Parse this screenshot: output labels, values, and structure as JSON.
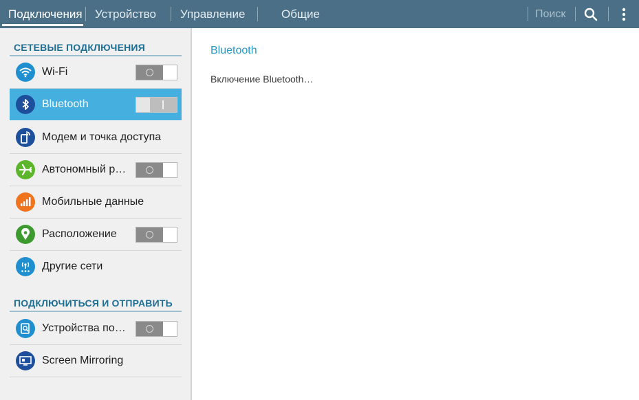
{
  "top_bar": {
    "tabs": [
      {
        "label": "Подключения",
        "active": true
      },
      {
        "label": "Устройство",
        "active": false
      },
      {
        "label": "Управление",
        "active": false
      },
      {
        "label": "Общие",
        "active": false
      }
    ],
    "search_label": "Поиск",
    "icons": [
      "search-icon",
      "overflow-menu-icon"
    ],
    "color": "#4b6f86"
  },
  "sidebar": {
    "sections": [
      {
        "header": "СЕТЕВЫЕ ПОДКЛЮЧЕНИЯ",
        "items": [
          {
            "label": "Wi-Fi",
            "icon": "wifi-icon",
            "icon_color": "#1f8fd0",
            "toggle": "off"
          },
          {
            "label": "Bluetooth",
            "icon": "bluetooth-icon",
            "icon_color": "#1e4f9c",
            "toggle": "turning-on",
            "selected": true
          },
          {
            "label": "Модем и точка доступа",
            "icon": "tethering-icon",
            "icon_color": "#1e4f9c"
          },
          {
            "label": "Автономный режим",
            "icon": "airplane-icon",
            "icon_color": "#5cb52a",
            "toggle": "off"
          },
          {
            "label": "Мобильные данные",
            "icon": "mobile-data-icon",
            "icon_color": "#f0731e"
          },
          {
            "label": "Расположение",
            "icon": "location-icon",
            "icon_color": "#3c9a2e",
            "toggle": "off"
          },
          {
            "label": "Другие сети",
            "icon": "other-networks-icon",
            "icon_color": "#1f8fd0"
          }
        ]
      },
      {
        "header": "ПОДКЛЮЧИТЬСЯ И ОТПРАВИТЬ",
        "items": [
          {
            "label": "Устройства поблизости",
            "icon": "nearby-devices-icon",
            "icon_color": "#1f8fd0",
            "toggle": "off"
          },
          {
            "label": "Screen Mirroring",
            "icon": "screen-mirroring-icon",
            "icon_color": "#1e4f9c"
          }
        ]
      }
    ],
    "selected_color": "#45afe0"
  },
  "detail": {
    "title": "Bluetooth",
    "status": "Включение Bluetooth…"
  }
}
